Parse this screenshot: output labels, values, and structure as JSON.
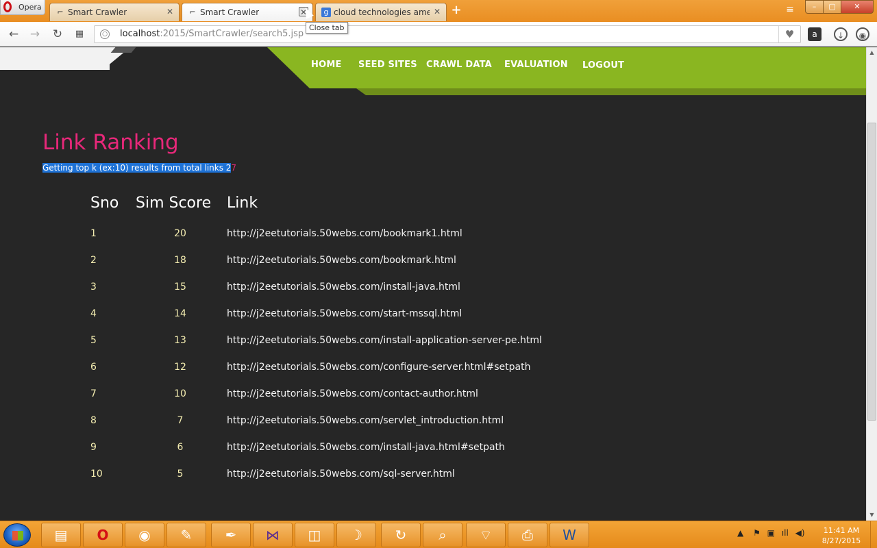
{
  "browser": {
    "opera_label": "Opera",
    "tabs": [
      {
        "label": "Smart Crawler",
        "icon": "crawler-favicon"
      },
      {
        "label": "Smart Crawler",
        "icon": "crawler-favicon",
        "active": true
      },
      {
        "label": "cloud technologies amee",
        "icon": "google-favicon"
      }
    ],
    "tooltip": "Close tab",
    "address": {
      "host": "localhost",
      "path": ":2015/SmartCrawler/search5.jsp"
    }
  },
  "nav": {
    "items": [
      "HOME",
      "SEED SITES",
      "CRAWL DATA",
      "EVALUATION",
      "LOGOUT"
    ],
    "color": "#8ab621"
  },
  "page": {
    "title": "Link Ranking",
    "subtitle_highlighted": "Getting top k (ex:10) results from total links 2",
    "subtitle_tail": "7",
    "title_color": "#e8287a"
  },
  "table": {
    "headers": [
      "Sno",
      "Sim Score",
      "Link"
    ],
    "rows": [
      {
        "sno": "1",
        "score": "20",
        "link": "http://j2eetutorials.50webs.com/bookmark1.html"
      },
      {
        "sno": "2",
        "score": "18",
        "link": "http://j2eetutorials.50webs.com/bookmark.html"
      },
      {
        "sno": "3",
        "score": "15",
        "link": "http://j2eetutorials.50webs.com/install-java.html"
      },
      {
        "sno": "4",
        "score": "14",
        "link": "http://j2eetutorials.50webs.com/start-mssql.html"
      },
      {
        "sno": "5",
        "score": "13",
        "link": "http://j2eetutorials.50webs.com/install-application-server-pe.html"
      },
      {
        "sno": "6",
        "score": "12",
        "link": "http://j2eetutorials.50webs.com/configure-server.html#setpath"
      },
      {
        "sno": "7",
        "score": "10",
        "link": "http://j2eetutorials.50webs.com/contact-author.html"
      },
      {
        "sno": "8",
        "score": "7",
        "link": "http://j2eetutorials.50webs.com/servlet_introduction.html"
      },
      {
        "sno": "9",
        "score": "6",
        "link": "http://j2eetutorials.50webs.com/install-java.html#setpath"
      },
      {
        "sno": "10",
        "score": "5",
        "link": "http://j2eetutorials.50webs.com/sql-server.html"
      }
    ]
  },
  "taskbar": {
    "apps": [
      "explorer-icon",
      "opera-icon",
      "chrome-icon",
      "paint-icon",
      "feather-icon",
      "visual-studio-icon",
      "camera-icon",
      "dolphin-icon",
      "sync-icon",
      "search-doc-icon",
      "wifi-icon",
      "pdf-icon",
      "word-icon"
    ],
    "time": "11:41 AM",
    "date": "8/27/2015"
  }
}
